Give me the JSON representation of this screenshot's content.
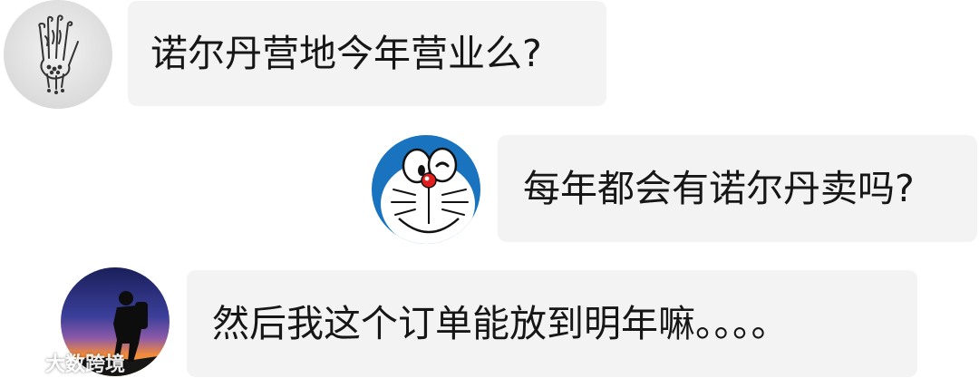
{
  "messages": [
    {
      "text": "诺尔丹营地今年营业么?",
      "avatar": "hand-sketch-avatar",
      "side": "left"
    },
    {
      "text": "每年都会有诺尔丹卖吗?",
      "avatar": "doraemon-avatar",
      "side": "right"
    },
    {
      "text": "然后我这个订单能放到明年嘛。。。。",
      "avatar": "sunset-hiker-avatar",
      "side": "left"
    }
  ],
  "watermark": {
    "text": "大数跨境"
  },
  "colors": {
    "bubble": "#f3f3f3",
    "text": "#161616",
    "background": "#ffffff"
  }
}
